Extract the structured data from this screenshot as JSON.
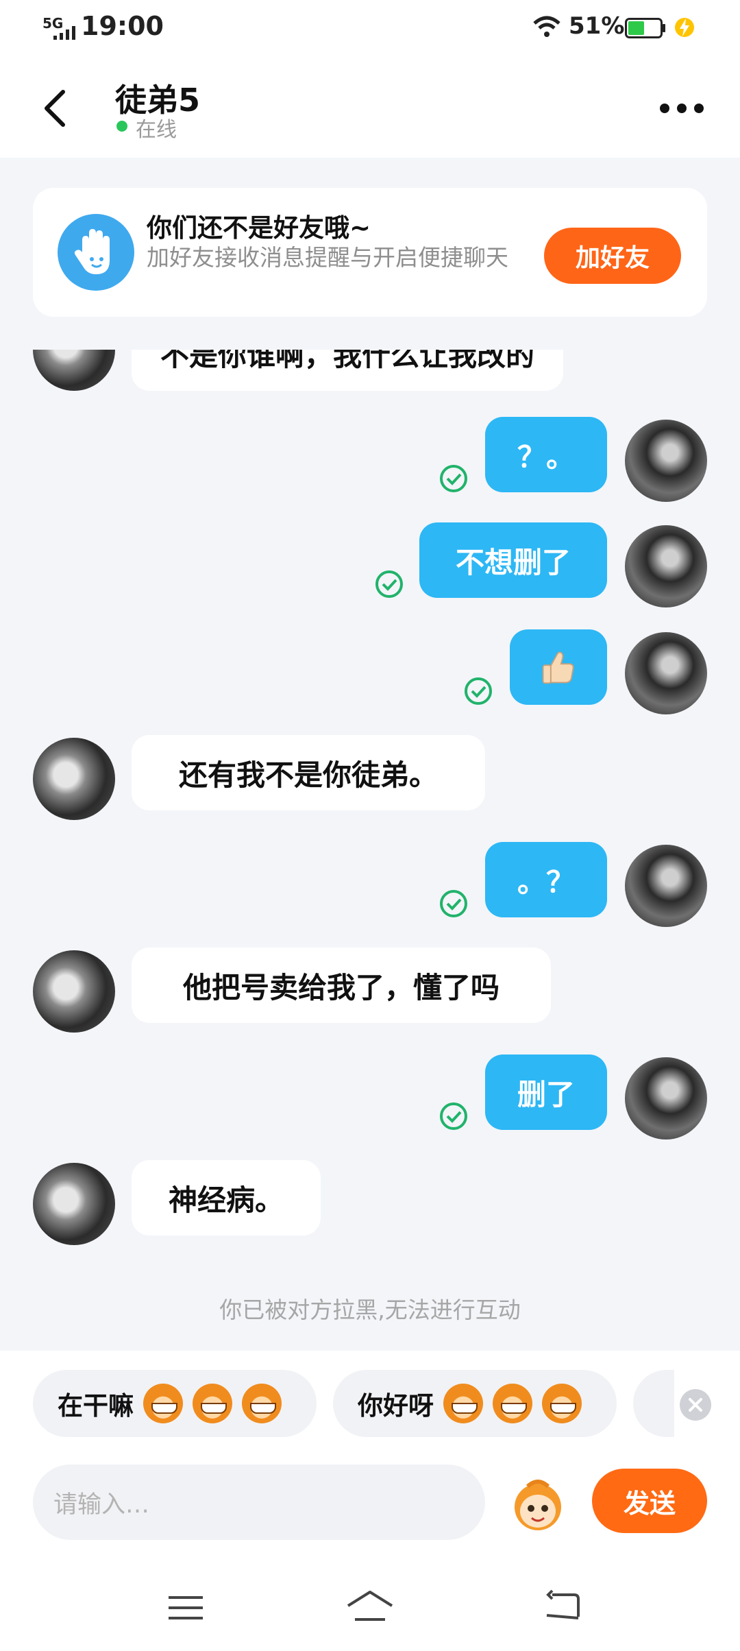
{
  "status_bar": {
    "network": "5G",
    "time": "19:00",
    "battery_percent": "51%",
    "battery_level": 0.51,
    "charging": true
  },
  "header": {
    "contact_name": "徒弟5",
    "status": "在线"
  },
  "friend_banner": {
    "title": "你们还不是好友哦~",
    "subtitle": "加好友接收消息提醒与开启便捷聊天",
    "button": "加好友"
  },
  "messages": [
    {
      "side": "in",
      "text": "不是你谁啊，我什么让我改的",
      "partial": true
    },
    {
      "side": "out",
      "text": "？。",
      "read": true
    },
    {
      "side": "out",
      "text": "不想删了",
      "read": true
    },
    {
      "side": "out",
      "text": "👍",
      "read": true
    },
    {
      "side": "in",
      "text": "还有我不是你徒弟。"
    },
    {
      "side": "out",
      "text": "。？",
      "read": true
    },
    {
      "side": "in",
      "text": "他把号卖给我了，懂了吗"
    },
    {
      "side": "out",
      "text": "删了",
      "read": true
    },
    {
      "side": "in",
      "text": "神经病。"
    }
  ],
  "system_note": "你已被对方拉黑,无法进行互动",
  "quick_replies": [
    {
      "text": "在干嘛",
      "emoji": "grinning-monkey",
      "emoji_count": 3
    },
    {
      "text": "你好呀",
      "emoji": "monkey-face",
      "emoji_count": 3
    }
  ],
  "input": {
    "placeholder": "请输入…",
    "send_label": "发送"
  },
  "colors": {
    "accent_orange": "#ff6517",
    "outgoing_bubble": "#2db7f5",
    "read_check": "#21b36b",
    "online": "#2bc65b"
  }
}
